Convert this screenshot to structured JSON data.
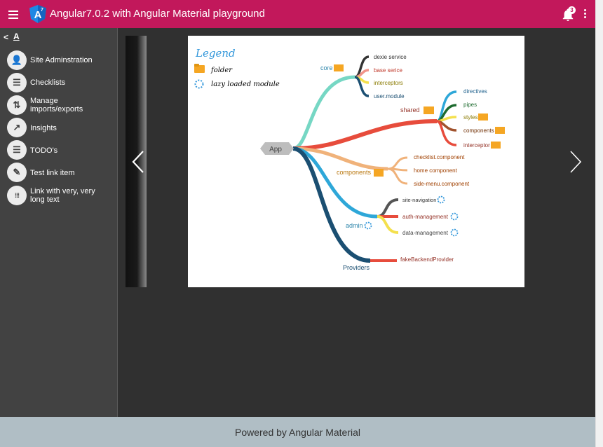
{
  "header": {
    "title": "Angular7.0.2 with Angular Material playground",
    "notification_count": "3",
    "logo_letter": "A",
    "logo_sub": "7"
  },
  "sidebar": {
    "collapse_glyph": "<",
    "font_glyph": "A",
    "items": [
      {
        "label": "Site Adminstration",
        "icon": "admin-user-icon",
        "glyph": "👤"
      },
      {
        "label": "Checklists",
        "icon": "list-icon",
        "glyph": "☰"
      },
      {
        "label": "Manage imports/exports",
        "icon": "import-export-icon",
        "glyph": "⇅"
      },
      {
        "label": "Insights",
        "icon": "trending-icon",
        "glyph": "↗"
      },
      {
        "label": "TODO's",
        "icon": "list-icon",
        "glyph": "☰"
      },
      {
        "label": "Test link item",
        "icon": "pencil-icon",
        "glyph": "✎"
      },
      {
        "label": "Link with very, very long text",
        "icon": "apps-grid-icon",
        "glyph": "⁞⁞⁞"
      }
    ]
  },
  "diagram": {
    "legend": {
      "title": "Legend",
      "folder": "folder",
      "lazy": "lazy loaded module"
    },
    "root": "App",
    "nodes": {
      "core": "core",
      "dexie": "dexie service",
      "base": "base serice",
      "interceptors": "interceptors",
      "usermodule": "user.module",
      "shared": "shared",
      "directives": "directives",
      "pipes": "pipes",
      "styles": "styles",
      "components_s": "components",
      "interceptor": "interceptor",
      "components": "components",
      "checklist": "checklist.component",
      "home": "home component",
      "sidemenu": "side-menu.component",
      "admin": "admin",
      "sitenav": "site-navigation",
      "authmgmt": "auth-management",
      "datamgmt": "data-management",
      "providers": "Providers",
      "fakebackend": "fakeBackendProvider"
    },
    "colors": {
      "core": "#76d7c4",
      "shared": "#e74c3c",
      "components": "#f0b27a",
      "admin": "#2ea7d8",
      "providers": "#1b4f72",
      "folder": "#f5a623",
      "lazy": "#3498db"
    }
  },
  "carousel": {
    "prev_glyph": "‹",
    "next_glyph": "›"
  },
  "footer": {
    "text": "Powered by Angular Material"
  }
}
